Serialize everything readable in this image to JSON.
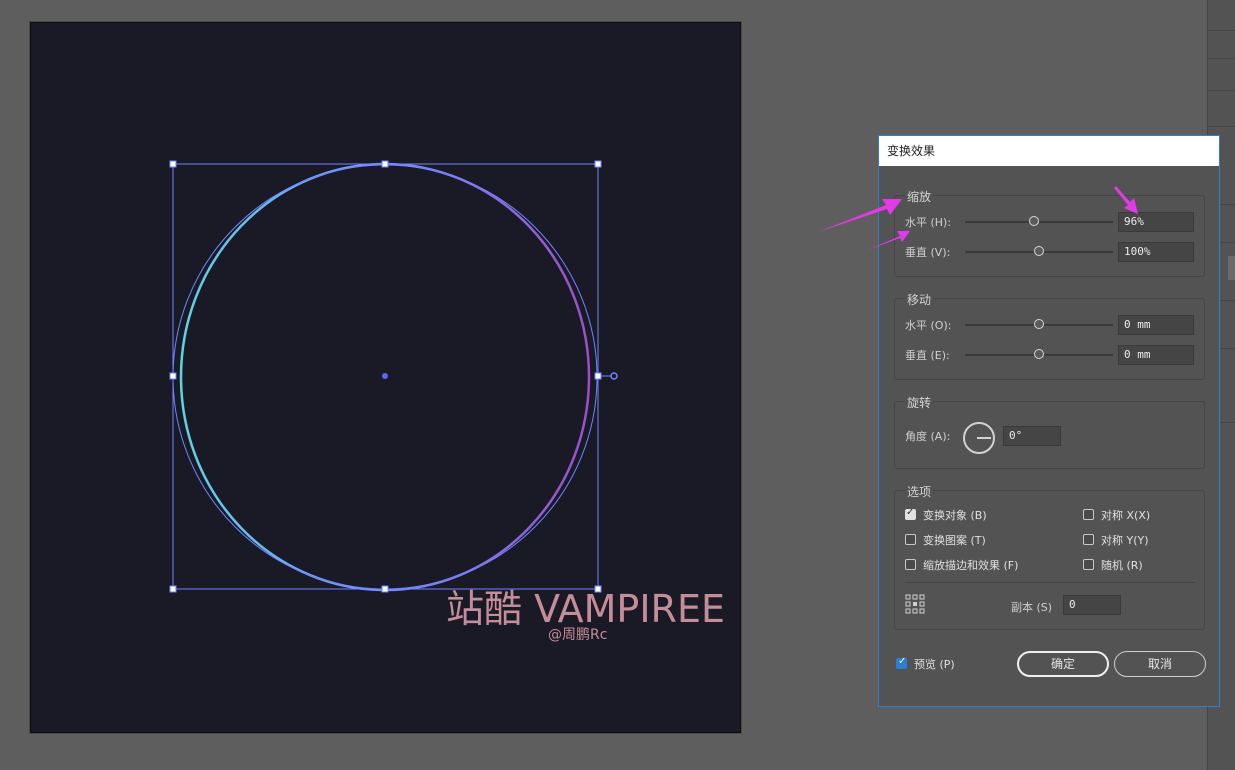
{
  "dialog": {
    "title": "变换效果",
    "scale": {
      "title": "缩放",
      "horizontal_label": "水平 (H):",
      "horizontal_value": "96%",
      "horizontal_level": 0.48,
      "vertical_label": "垂直 (V):",
      "vertical_value": "100%",
      "vertical_level": 0.5
    },
    "move": {
      "title": "移动",
      "horizontal_label": "水平 (O):",
      "horizontal_value": "0 mm",
      "horizontal_level": 0.5,
      "vertical_label": "垂直 (E):",
      "vertical_value": "0 mm",
      "vertical_level": 0.5
    },
    "rotate": {
      "title": "旋转",
      "angle_label": "角度 (A):",
      "angle_value": "0°"
    },
    "options": {
      "title": "选项",
      "transform_objects": "变换对象 (B)",
      "transform_objects_checked": true,
      "transform_patterns": "变换图案 (T)",
      "scale_strokes": "缩放描边和效果 (F)",
      "reflect_x": "对称 X(X)",
      "reflect_y": "对称 Y(Y)",
      "random": "随机 (R)",
      "copies_label": "副本 (S)",
      "copies_value": "0"
    },
    "preview_label": "预览 (P)",
    "preview_checked": true,
    "ok_label": "确定",
    "cancel_label": "取消"
  },
  "watermark": {
    "main": "站酷 VAMPIREE",
    "sub": "@周鹏Rc"
  },
  "colors": {
    "artboard": "#1a1a26",
    "selection": "#6e86ff",
    "arrow": "#e23ae8",
    "dialog_border": "#2f7fd1"
  }
}
